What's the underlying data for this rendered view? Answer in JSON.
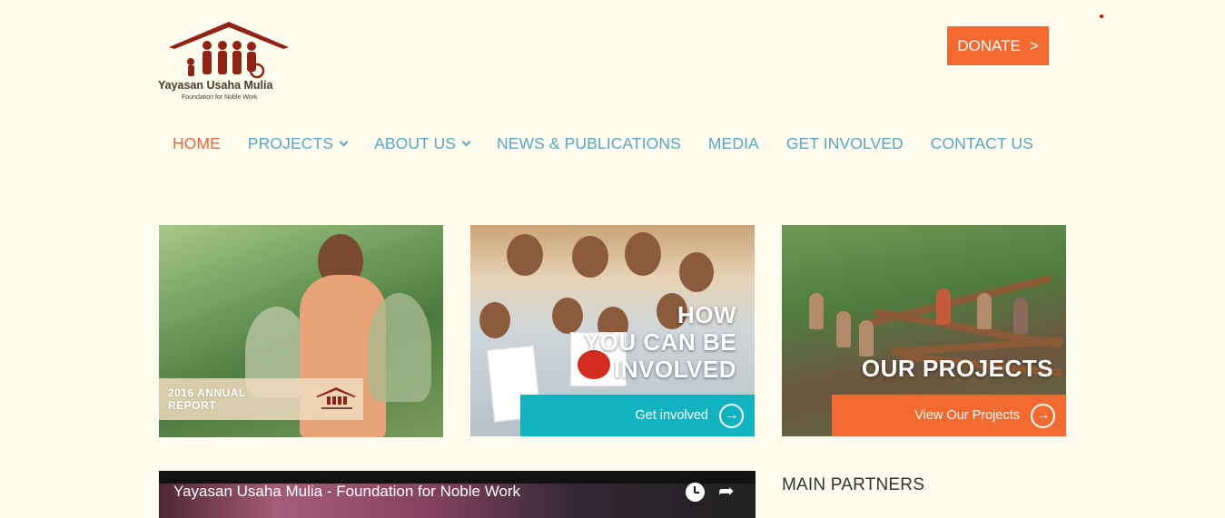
{
  "logo": {
    "title": "Yayasan Usaha Mulia",
    "subtitle": "Foundation for Noble Work"
  },
  "header": {
    "donate_label": "DONATE",
    "donate_arrow": ">"
  },
  "nav": [
    {
      "label": "HOME",
      "active": true,
      "dropdown": false
    },
    {
      "label": "PROJECTS",
      "active": false,
      "dropdown": true
    },
    {
      "label": "ABOUT US",
      "active": false,
      "dropdown": true
    },
    {
      "label": "NEWS & PUBLICATIONS",
      "active": false,
      "dropdown": false
    },
    {
      "label": "MEDIA",
      "active": false,
      "dropdown": false
    },
    {
      "label": "GET INVOLVED",
      "active": false,
      "dropdown": false
    },
    {
      "label": "CONTACT US",
      "active": false,
      "dropdown": false
    }
  ],
  "tiles": {
    "annual_report": {
      "label": "2016 ANNUAL REPORT"
    },
    "involved": {
      "heading_line1": "HOW",
      "heading_line2": "YOU CAN BE",
      "heading_line3": "INVOLVED",
      "cta": "Get involved"
    },
    "projects": {
      "heading": "OUR PROJECTS",
      "cta": "View Our Projects"
    }
  },
  "video": {
    "title": "Yayasan Usaha Mulia - Foundation for Noble Work"
  },
  "sidebar": {
    "partners_heading": "MAIN PARTNERS"
  },
  "colors": {
    "background": "#fdfcef",
    "accent_orange": "#f26a30",
    "nav_blue": "#5aa6c0",
    "teal": "#12b3c0",
    "logo_red": "#8f2416"
  }
}
